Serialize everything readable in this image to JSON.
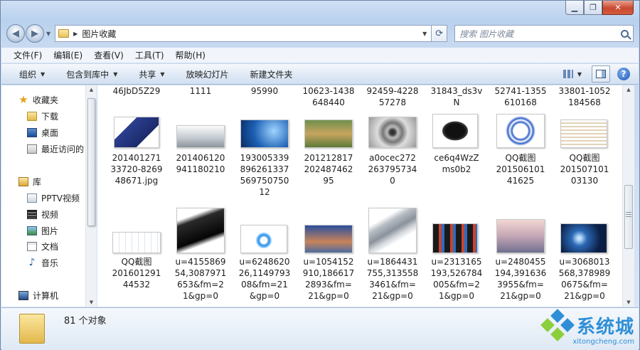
{
  "window": {
    "minimize": "▁",
    "restore": "❐",
    "close": "✕"
  },
  "address": {
    "path": "图片收藏",
    "separator": "▶",
    "search_placeholder": "搜索 图片收藏"
  },
  "menu": [
    "文件(F)",
    "编辑(E)",
    "查看(V)",
    "工具(T)",
    "帮助(H)"
  ],
  "commands": [
    {
      "label": "组织",
      "dropdown": true
    },
    {
      "label": "包含到库中",
      "dropdown": true
    },
    {
      "label": "共享",
      "dropdown": true
    },
    {
      "label": "放映幻灯片",
      "dropdown": false
    },
    {
      "label": "新建文件夹",
      "dropdown": false
    }
  ],
  "nav": [
    {
      "label": "收藏夹",
      "icon": "star-icon"
    },
    {
      "label": "下载",
      "icon": "downloads-folder-icon"
    },
    {
      "label": "桌面",
      "icon": "desktop-icon"
    },
    {
      "label": "最近访问的",
      "icon": "recent-places-icon"
    },
    {
      "label": "库",
      "icon": "libraries-icon"
    },
    {
      "label": "PPTV视频",
      "icon": "pptv-icon"
    },
    {
      "label": "视频",
      "icon": "videos-icon"
    },
    {
      "label": "图片",
      "icon": "pictures-icon"
    },
    {
      "label": "文档",
      "icon": "documents-icon"
    },
    {
      "label": "音乐",
      "icon": "music-icon"
    },
    {
      "label": "计算机",
      "icon": "computer-icon"
    }
  ],
  "files_row0": [
    "46JbD5Z29",
    "1111",
    "95990",
    "10623-1438\n648440",
    "92459-4228\n57278",
    "31843_ds3v\nN",
    "52741-1355\n610168",
    "33801-1052\n184568"
  ],
  "files_row1": [
    "201401271\n33720-8269\n48671.jpg",
    "201406120\n941180210",
    "193005339\n896261337\n569750750\n12",
    "201212817\n202487462\n95",
    "a0ocec272\n263795734\n0",
    "ce6q4WzZ\nms0b2",
    "QQ截图\n201506101\n41625",
    "QQ截图\n201507101\n03130"
  ],
  "files_row2": [
    "QQ截图\n201601291\n44532",
    "u=4155869\n54,3087971\n653&fm=2\n1&gp=0",
    "u=6248620\n26,1149793\n08&fm=21\n&gp=0",
    "u=1054152\n910,186617\n2893&fm=\n21&gp=0",
    "u=1864431\n755,313558\n3461&fm=\n21&gp=0",
    "u=2313165\n193,526784\n005&fm=2\n1&gp=0",
    "u=2480455\n194,391636\n3955&fm=\n21&gp=0",
    "u=3068013\n568,378989\n0675&fm=\n21&gp=0"
  ],
  "status": {
    "count": "81 个对象"
  },
  "brand": {
    "name": "系统城",
    "url": "xitongcheng.com"
  }
}
